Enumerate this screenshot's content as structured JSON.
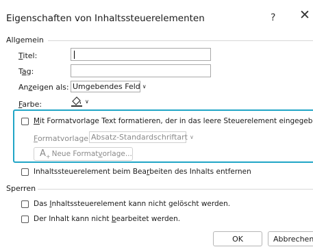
{
  "dialog": {
    "title": "Eigenschaften von Inhaltssteuerelementen",
    "help": "?",
    "close": "✕"
  },
  "general": {
    "label": "Allgemein",
    "title_label": "Titel:",
    "title_value": "",
    "tag_label": "Tag:",
    "tag_value": "",
    "show_as_label": "Anzeigen als:",
    "show_as_value": "Umgebendes Feld",
    "color_label": "Farbe:",
    "format_checkbox_label": "Mit Formatvorlage Text formatieren, der in das leere Steuerelement eingegeben wir",
    "format_checked": false,
    "style_label": "Formatvorlage:",
    "style_value": "Absatz-Standardschriftart",
    "new_style_button": "Neue Formatvorlage...",
    "remove_checkbox_label": "Inhaltssteuerelement beim Bearbeiten des Inhalts entfernen",
    "remove_checked": false
  },
  "locking": {
    "label": "Sperren",
    "no_delete_label": "Das Inhaltssteuerelement kann nicht gelöscht werden.",
    "no_delete_checked": false,
    "no_edit_label": "Der Inhalt kann nicht bearbeitet werden.",
    "no_edit_checked": false
  },
  "buttons": {
    "ok": "OK",
    "cancel": "Abbrechen"
  }
}
